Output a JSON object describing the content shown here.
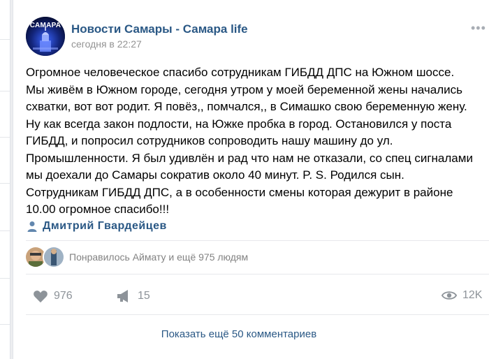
{
  "post": {
    "group_name": "Новости Самары - Самара life",
    "avatar_text": "САМАРА",
    "time": "сегодня в 22:27",
    "text": "Огромное человеческое спасибо сотрудникам ГИБДД ДПС на Южном шоссе.\nМы живём в Южном городе, сегодня утром у моей беременной жены начались\nсхватки, вот вот родит. Я повёз,, помчался,, в Симашко свою беременную жену.\nНу как всегда закон подлости, на Южке пробка в город. Остановился у поста\nГИБДД, и попросил сотрудников сопроводить нашу машину до ул.\nПромышленности. Я был удивлён и рад что нам не отказали, со спец сигналами\nмы доехали до Самары сократив около 40 минут. P. S. Родился сын.\nСотрудникам ГИБДД ДПС, а в особенности смены которая дежурит в районе\n10.00 огромное спасибо!!!",
    "author": "Дмитрий Гвардейцев",
    "likes_text": "Понравилось Аймату и ещё 975 людям"
  },
  "actions": {
    "likes": "976",
    "shares": "15",
    "views": "12K"
  },
  "comments": {
    "show_more": "Показать ещё 50 комментариев"
  },
  "colors": {
    "link": "#2a5885",
    "muted": "#939393",
    "icon": "#a8adb4"
  },
  "icons": [
    "user-icon",
    "heart-icon",
    "megaphone-icon",
    "eye-icon",
    "more-icon"
  ]
}
